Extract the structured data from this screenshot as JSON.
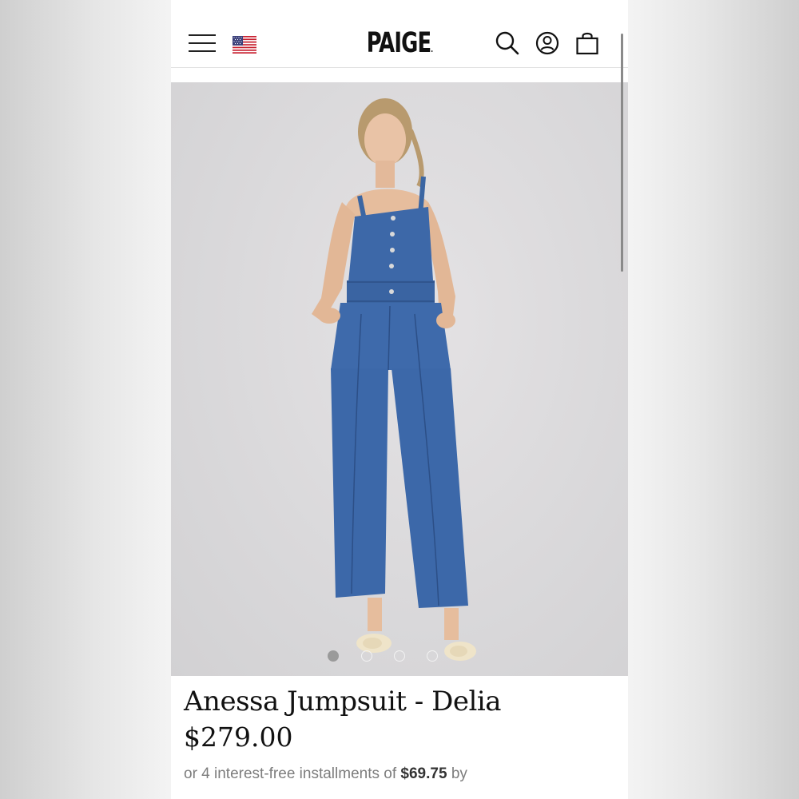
{
  "header": {
    "logo": "PAIGE",
    "logo_mark": ".",
    "flag": "us-flag-icon",
    "icons": [
      "menu-icon",
      "search-icon",
      "account-icon",
      "bag-icon"
    ]
  },
  "gallery": {
    "image_index": 1,
    "image_count": 4
  },
  "product": {
    "title": "Anessa Jumpsuit - Delia",
    "price": "$279.00",
    "installments_prefix": "or 4 interest-free installments of",
    "installments_amount": "$69.75",
    "installments_suffix": "by"
  },
  "colors": {
    "denim": "#3d68a8",
    "text": "#111111",
    "muted": "#7d7d7d"
  }
}
